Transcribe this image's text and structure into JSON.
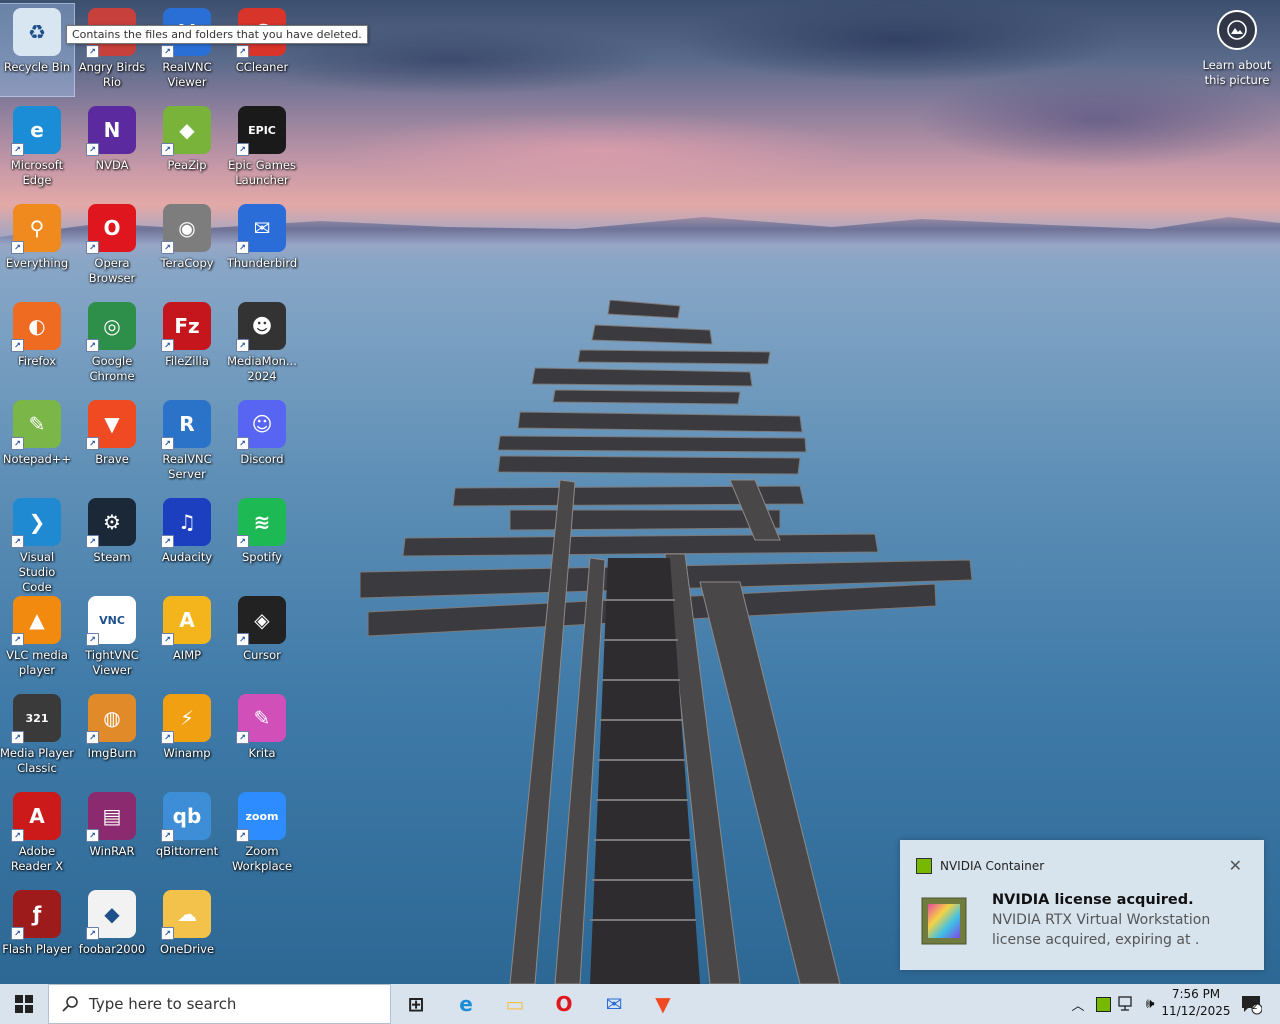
{
  "desktop": {
    "tooltip": "Contains the files and folders that you have deleted.",
    "icons": [
      {
        "label": "Recycle Bin",
        "icon": "recycle-bin-icon",
        "color": "#d8e6f2",
        "glyph": "♻",
        "shortcut": false
      },
      {
        "label": "Angry Birds\nRio",
        "icon": "angry-birds-icon",
        "color": "#c7403b",
        "glyph": "●",
        "shortcut": true
      },
      {
        "label": "RealVNC\nViewer",
        "icon": "realvnc-viewer-icon",
        "color": "#2a6fd6",
        "glyph": "V",
        "shortcut": true
      },
      {
        "label": "CCleaner",
        "icon": "ccleaner-icon",
        "color": "#d8342a",
        "glyph": "C",
        "shortcut": true
      },
      {
        "label": "Microsoft\nEdge",
        "icon": "edge-icon",
        "color": "#1b8dd6",
        "glyph": "e",
        "shortcut": true
      },
      {
        "label": "NVDA",
        "icon": "nvda-icon",
        "color": "#5b2a9e",
        "glyph": "N",
        "shortcut": true
      },
      {
        "label": "PeaZip",
        "icon": "peazip-icon",
        "color": "#79b33a",
        "glyph": "◆",
        "shortcut": true
      },
      {
        "label": "Epic Games\nLauncher",
        "icon": "epic-games-icon",
        "color": "#1a1a1a",
        "glyph": "EPIC",
        "shortcut": true
      },
      {
        "label": "Everything",
        "icon": "everything-search-icon",
        "color": "#f08a1e",
        "glyph": "⚲",
        "shortcut": true
      },
      {
        "label": "Opera\nBrowser",
        "icon": "opera-icon",
        "color": "#e0161e",
        "glyph": "O",
        "shortcut": true
      },
      {
        "label": "TeraCopy",
        "icon": "teracopy-icon",
        "color": "#7d7d7d",
        "glyph": "◉",
        "shortcut": true
      },
      {
        "label": "Thunderbird",
        "icon": "thunderbird-icon",
        "color": "#2a6cd8",
        "glyph": "✉",
        "shortcut": true
      },
      {
        "label": "Firefox",
        "icon": "firefox-icon",
        "color": "#ef6b22",
        "glyph": "◐",
        "shortcut": true
      },
      {
        "label": "Google\nChrome",
        "icon": "chrome-icon",
        "color": "#2e8f4a",
        "glyph": "◎",
        "shortcut": true
      },
      {
        "label": "FileZilla",
        "icon": "filezilla-icon",
        "color": "#c4161c",
        "glyph": "Fz",
        "shortcut": true
      },
      {
        "label": "MediaMon...\n2024",
        "icon": "mediamonkey-icon",
        "color": "#333333",
        "glyph": "☻",
        "shortcut": true
      },
      {
        "label": "Notepad++",
        "icon": "notepad-plus-plus-icon",
        "color": "#7ab648",
        "glyph": "✎",
        "shortcut": true
      },
      {
        "label": "Brave",
        "icon": "brave-icon",
        "color": "#f04a23",
        "glyph": "▼",
        "shortcut": true
      },
      {
        "label": "RealVNC\nServer",
        "icon": "realvnc-server-icon",
        "color": "#2b72c9",
        "glyph": "R",
        "shortcut": true
      },
      {
        "label": "Discord",
        "icon": "discord-icon",
        "color": "#5865f2",
        "glyph": "☺",
        "shortcut": true
      },
      {
        "label": "Visual Studio\nCode",
        "icon": "vscode-icon",
        "color": "#1f8ad2",
        "glyph": "❯",
        "shortcut": true
      },
      {
        "label": "Steam",
        "icon": "steam-icon",
        "color": "#1b2838",
        "glyph": "⚙",
        "shortcut": true
      },
      {
        "label": "Audacity",
        "icon": "audacity-icon",
        "color": "#1b3fbf",
        "glyph": "♫",
        "shortcut": true
      },
      {
        "label": "Spotify",
        "icon": "spotify-icon",
        "color": "#1db954",
        "glyph": "≋",
        "shortcut": true
      },
      {
        "label": "VLC media\nplayer",
        "icon": "vlc-icon",
        "color": "#f28a0f",
        "glyph": "▲",
        "shortcut": true
      },
      {
        "label": "TightVNC\nViewer",
        "icon": "tightvnc-icon",
        "color": "#ffffff",
        "glyph": "VNC",
        "shortcut": true
      },
      {
        "label": "AIMP",
        "icon": "aimp-icon",
        "color": "#f3b51b",
        "glyph": "A",
        "shortcut": true
      },
      {
        "label": "Cursor",
        "icon": "cursor-icon",
        "color": "#222222",
        "glyph": "◈",
        "shortcut": true
      },
      {
        "label": "Media Player\nClassic",
        "icon": "mpc-icon",
        "color": "#3a3a3a",
        "glyph": "321",
        "shortcut": true
      },
      {
        "label": "ImgBurn",
        "icon": "imgburn-icon",
        "color": "#e08a2a",
        "glyph": "◍",
        "shortcut": true
      },
      {
        "label": "Winamp",
        "icon": "winamp-icon",
        "color": "#f0a010",
        "glyph": "⚡",
        "shortcut": true
      },
      {
        "label": "Krita",
        "icon": "krita-icon",
        "color": "#d14fb8",
        "glyph": "✎",
        "shortcut": true
      },
      {
        "label": "Adobe\nReader X",
        "icon": "adobe-reader-icon",
        "color": "#cc1a1a",
        "glyph": "A",
        "shortcut": true
      },
      {
        "label": "WinRAR",
        "icon": "winrar-icon",
        "color": "#8b2a6e",
        "glyph": "▤",
        "shortcut": true
      },
      {
        "label": "qBittorrent",
        "icon": "qbittorrent-icon",
        "color": "#3d8ed6",
        "glyph": "qb",
        "shortcut": true
      },
      {
        "label": "Zoom\nWorkplace",
        "icon": "zoom-icon",
        "color": "#2d8cff",
        "glyph": "zoom",
        "shortcut": true
      },
      {
        "label": "Flash Player",
        "icon": "flash-player-icon",
        "color": "#9e1b1b",
        "glyph": "ƒ",
        "shortcut": true
      },
      {
        "label": "foobar2000",
        "icon": "foobar2000-icon",
        "color": "#f2f2f2",
        "glyph": "◆",
        "shortcut": true
      },
      {
        "label": "OneDrive",
        "icon": "onedrive-icon",
        "color": "#f3c24a",
        "glyph": "☁",
        "shortcut": true
      }
    ],
    "learn": {
      "label": "Learn about\nthis picture",
      "icon": "camera-icon"
    }
  },
  "toast": {
    "app_name": "NVIDIA Container",
    "title": "NVIDIA license acquired.",
    "line1": "NVIDIA RTX Virtual Workstation",
    "line2": "license acquired, expiring at .",
    "accent": "#76b900"
  },
  "taskbar": {
    "search_placeholder": "Type here to search",
    "pinned": [
      {
        "name": "task-view-icon",
        "glyph": "⊞",
        "color": "#222222"
      },
      {
        "name": "edge-taskbar-icon",
        "glyph": "e",
        "color": "#1b8dd6"
      },
      {
        "name": "file-explorer-icon",
        "glyph": "▭",
        "color": "#f3c24a"
      },
      {
        "name": "opera-taskbar-icon",
        "glyph": "O",
        "color": "#e0161e"
      },
      {
        "name": "thunderbird-taskbar-icon",
        "glyph": "✉",
        "color": "#2a6cd8"
      },
      {
        "name": "brave-taskbar-icon",
        "glyph": "▼",
        "color": "#f04a23"
      }
    ],
    "tray": {
      "time": "7:56 PM",
      "date": "11/12/2025",
      "notification_count": "2"
    }
  }
}
